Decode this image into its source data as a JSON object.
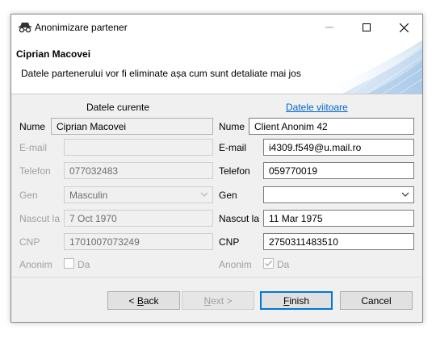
{
  "window": {
    "title": "Anonimizare partener",
    "controls": {
      "minimize": "minimize-icon",
      "maximize": "maximize-icon",
      "close": "close-icon"
    }
  },
  "header": {
    "partner_name": "Ciprian Macovei",
    "description": "Datele partenerului vor fi eliminate așa cum sunt detaliate mai jos"
  },
  "columns": {
    "current": "Datele curente",
    "future": "Datele viitoare"
  },
  "current": {
    "nume_label": "Nume",
    "nume_value": "Ciprian Macovei",
    "email_label": "E-mail",
    "email_value": "",
    "telefon_label": "Telefon",
    "telefon_value": "077032483",
    "gen_label": "Gen",
    "gen_value": "Masculin",
    "nascut_label": "Nascut la",
    "nascut_value": "7 Oct 1970",
    "cnp_label": "CNP",
    "cnp_value": "1701007073249",
    "anonim_label": "Anonim",
    "anonim_checkbox_label": "Da",
    "anonim_checked": false
  },
  "future": {
    "nume_label": "Nume",
    "nume_value": "Client Anonim 42",
    "email_label": "E-mail",
    "email_value": "i4309.f549@u.mail.ro",
    "telefon_label": "Telefon",
    "telefon_value": "059770019",
    "gen_label": "Gen",
    "gen_value": "",
    "nascut_label": "Nascut la",
    "nascut_value": "11 Mar 1975",
    "cnp_label": "CNP",
    "cnp_value": "2750311483510",
    "anonim_label": "Anonim",
    "anonim_checkbox_label": "Da",
    "anonim_checked": true
  },
  "buttons": {
    "back_prefix": "< ",
    "back_mnemonic": "B",
    "back_rest": "ack",
    "next_mnemonic": "N",
    "next_rest": "ext >",
    "finish_mnemonic": "F",
    "finish_rest": "inish",
    "cancel": "Cancel"
  },
  "colors": {
    "link": "#0066cc",
    "body_bg": "#f0f0f0",
    "accent": "#0078d7",
    "disabled_text": "#a0a0a0"
  }
}
